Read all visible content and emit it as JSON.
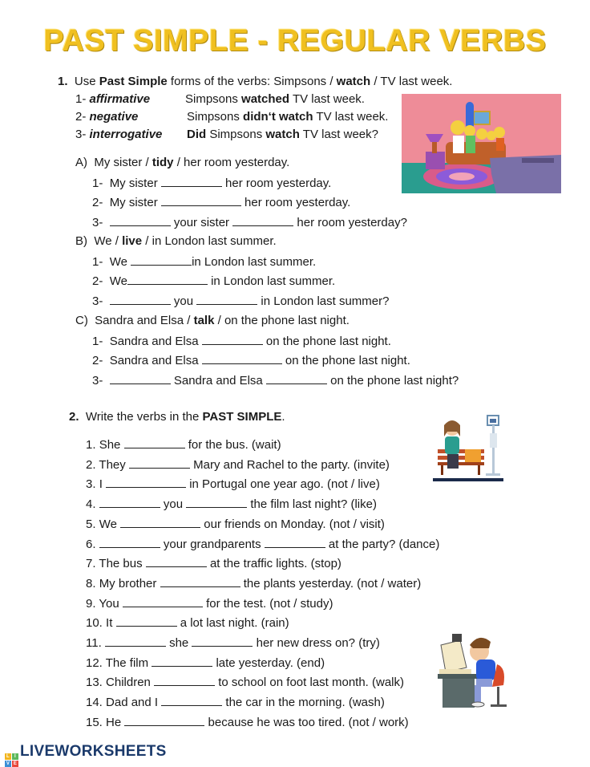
{
  "title": "PAST SIMPLE - REGULAR VERBS",
  "section1": {
    "number": "1.",
    "instruction_pre": "Use ",
    "instruction_bold": "Past Simple",
    "instruction_mid": " forms of the verbs:  Simpsons / ",
    "instruction_verb": "watch",
    "instruction_post": " / TV last week.",
    "examples": [
      {
        "num": "1-",
        "type": "affirmative",
        "pre": "Simpsons ",
        "bold": "watched",
        "post": " TV last week."
      },
      {
        "num": "2-",
        "type": "negative",
        "pre": "Simpsons ",
        "bold": "didn‘t watch",
        "post": " TV last week."
      },
      {
        "num": "3-",
        "type": "interrogative",
        "bold1": "Did",
        "mid": " Simpsons ",
        "bold2": "watch",
        "post": " TV last week?"
      }
    ],
    "image": "simpsons-family-watching-tv",
    "parts": [
      {
        "letter": "A)",
        "prompt_pre": "My sister / ",
        "verb": "tidy",
        "prompt_post": " / her room yesterday.",
        "items": [
          {
            "num": "1-",
            "a": "My sister ",
            "b": " her room yesterday."
          },
          {
            "num": "2-",
            "a": "My sister ",
            "b": " her room yesterday."
          },
          {
            "num": "3-",
            "a": " your sister ",
            "b": " her room yesterday?"
          }
        ]
      },
      {
        "letter": "B)",
        "prompt_pre": "We / ",
        "verb": "live",
        "prompt_post": " / in London last summer.",
        "items": [
          {
            "num": "1-",
            "a": "We ",
            "b": "in London last summer."
          },
          {
            "num": "2-",
            "a": "We",
            "b": " in London last summer."
          },
          {
            "num": "3-",
            "a": " you ",
            "b": " in London last summer?"
          }
        ]
      },
      {
        "letter": "C)",
        "prompt_pre": "Sandra and Elsa / ",
        "verb": "talk",
        "prompt_post": " / on the phone last night.",
        "items": [
          {
            "num": "1-",
            "a": "Sandra and Elsa ",
            "b": " on the phone last night."
          },
          {
            "num": "2-",
            "a": "Sandra and Elsa ",
            "b": " on the phone last night."
          },
          {
            "num": "3-",
            "a": " Sandra and Elsa ",
            "b": " on the phone last night?"
          }
        ]
      }
    ]
  },
  "section2": {
    "number": "2.",
    "instruction_pre": "Write the verbs in the ",
    "instruction_bold": "PAST SIMPLE",
    "instruction_post": ".",
    "images": [
      "woman-waiting-at-bus-stop",
      "tired-boy-at-computer"
    ],
    "items": [
      {
        "num": "1.",
        "parts": [
          "She ",
          " for the bus. (wait)"
        ]
      },
      {
        "num": "2.",
        "parts": [
          "They ",
          " Mary and Rachel to the party. (invite)"
        ]
      },
      {
        "num": "3.",
        "parts": [
          "I ",
          " in Portugal one year ago. (not / live)"
        ]
      },
      {
        "num": "4.",
        "parts": [
          "",
          " you ",
          " the film last night? (like)"
        ]
      },
      {
        "num": "5.",
        "parts": [
          "We ",
          " our friends on Monday. (not / visit)"
        ]
      },
      {
        "num": "6.",
        "parts": [
          "",
          " your grandparents ",
          " at the party? (dance)"
        ]
      },
      {
        "num": "7.",
        "parts": [
          "The bus ",
          " at the traffic lights. (stop)"
        ]
      },
      {
        "num": "8.",
        "parts": [
          "My brother ",
          " the plants yesterday. (not / water)"
        ]
      },
      {
        "num": "9.",
        "parts": [
          "You ",
          " for the test. (not / study)"
        ]
      },
      {
        "num": "10.",
        "parts": [
          "It ",
          " a lot last night. (rain)"
        ]
      },
      {
        "num": "11.",
        "parts": [
          "",
          " she ",
          " her new dress on? (try)"
        ]
      },
      {
        "num": "12.",
        "parts": [
          "The film ",
          " late yesterday. (end)"
        ]
      },
      {
        "num": "13.",
        "parts": [
          "Children ",
          " to school on foot last month. (walk)"
        ]
      },
      {
        "num": "14.",
        "parts": [
          "Dad and I ",
          " the car in the morning. (wash)"
        ]
      },
      {
        "num": "15.",
        "parts": [
          "He ",
          " because he was too tired. (not / work)"
        ]
      }
    ]
  },
  "footer": {
    "brand": "LIVEWORKSHEETS",
    "logo_letters": [
      "L",
      "I",
      "V",
      "E"
    ],
    "logo_colors": [
      "#f2b51e",
      "#5cb85c",
      "#3b8fd6",
      "#e8473c"
    ]
  }
}
